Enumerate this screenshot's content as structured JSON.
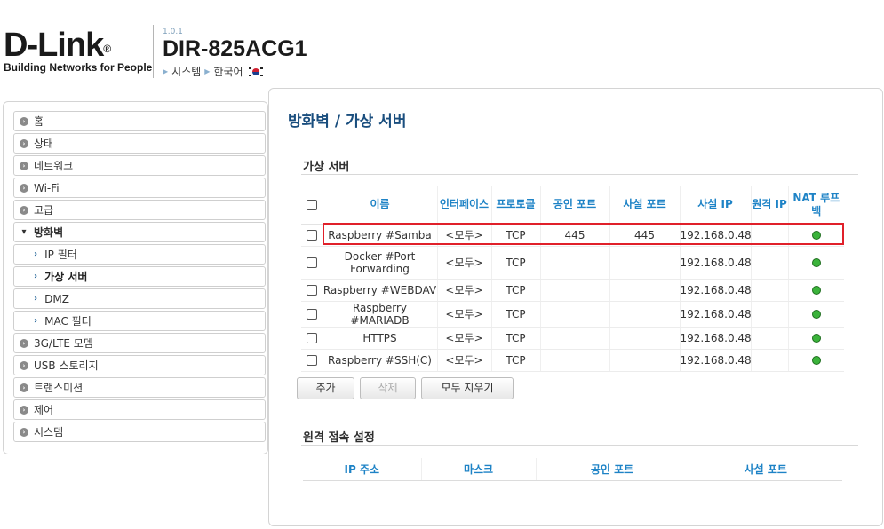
{
  "header": {
    "brand": "D-Link",
    "registered": "®",
    "tagline": "Building Networks for People",
    "firmware": "1.0.1",
    "model": "DIR-825ACG1",
    "crumb_system": "시스템",
    "crumb_language": "한국어"
  },
  "sidebar": {
    "items": [
      {
        "label": "홈"
      },
      {
        "label": "상태"
      },
      {
        "label": "네트워크"
      },
      {
        "label": "Wi-Fi"
      },
      {
        "label": "고급"
      },
      {
        "label": "방화벽"
      },
      {
        "label": "IP 필터"
      },
      {
        "label": "가상 서버"
      },
      {
        "label": "DMZ"
      },
      {
        "label": "MAC 필터"
      },
      {
        "label": "3G/LTE 모뎀"
      },
      {
        "label": "USB 스토리지"
      },
      {
        "label": "트랜스미션"
      },
      {
        "label": "제어"
      },
      {
        "label": "시스템"
      }
    ]
  },
  "main": {
    "breadcrumb_parent": "방화벽 /",
    "breadcrumb_current": "가상 서버",
    "section_title": "가상 서버",
    "columns": [
      "이름",
      "인터페이스",
      "프로토콜",
      "공인 포트",
      "사설 포트",
      "사설 IP",
      "원격 IP",
      "NAT 루프백"
    ],
    "rows": [
      {
        "name": "Raspberry #Samba",
        "iface": "<모두>",
        "proto": "TCP",
        "pub": "445",
        "priv": "445",
        "ip": "192.168.0.48",
        "remote": ""
      },
      {
        "name": "Docker #Port Forwarding",
        "iface": "<모두>",
        "proto": "TCP",
        "pub": "",
        "priv": "",
        "ip": "192.168.0.48",
        "remote": ""
      },
      {
        "name": "Raspberry #WEBDAV",
        "iface": "<모두>",
        "proto": "TCP",
        "pub": "",
        "priv": "",
        "ip": "192.168.0.48",
        "remote": ""
      },
      {
        "name": "Raspberry #MARIADB",
        "iface": "<모두>",
        "proto": "TCP",
        "pub": "",
        "priv": "",
        "ip": "192.168.0.48",
        "remote": ""
      },
      {
        "name": "HTTPS",
        "iface": "<모두>",
        "proto": "TCP",
        "pub": "",
        "priv": "",
        "ip": "192.168.0.48",
        "remote": ""
      },
      {
        "name": "Raspberry #SSH(C)",
        "iface": "<모두>",
        "proto": "TCP",
        "pub": "",
        "priv": "",
        "ip": "192.168.0.48",
        "remote": ""
      }
    ],
    "add_label": "추가",
    "delete_label": "삭제",
    "clear_all_label": "모두 지우기",
    "remote_section_title": "원격 접속 설정",
    "remote_columns": [
      "IP 주소",
      "마스크",
      "공인 포트",
      "사설 포트"
    ]
  },
  "colors": {
    "accent_blue": "#1e83c6",
    "title_blue": "#1a4e7e",
    "status_green": "#3bb33b",
    "highlight_red": "#e0202a"
  }
}
